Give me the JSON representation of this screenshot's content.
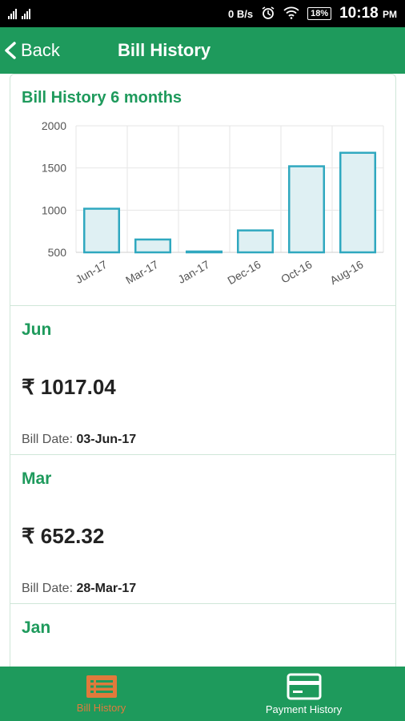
{
  "status_bar": {
    "network_speed": "0 B/s",
    "battery": "18%",
    "time": "10:18",
    "ampm": "PM"
  },
  "app_bar": {
    "back_label": "Back",
    "title": "Bill History"
  },
  "chart_card": {
    "title": "Bill History 6 months"
  },
  "chart_data": {
    "type": "bar",
    "categories": [
      "Jun-17",
      "Mar-17",
      "Jan-17",
      "Dec-16",
      "Oct-16",
      "Aug-16"
    ],
    "values": [
      1017.04,
      652.32,
      510,
      760,
      1520,
      1680
    ],
    "ylim": [
      500,
      2000
    ],
    "yticks": [
      500,
      1000,
      1500,
      2000
    ],
    "grid": true,
    "bar_fill": "#dff0f3",
    "bar_stroke": "#2fa8bf"
  },
  "bills": [
    {
      "month": "Jun",
      "currency": "₹",
      "amount": "1017.04",
      "date_label": "Bill Date:",
      "date": "03-Jun-17"
    },
    {
      "month": "Mar",
      "currency": "₹",
      "amount": "652.32",
      "date_label": "Bill Date:",
      "date": "28-Mar-17"
    },
    {
      "month": "Jan",
      "currency": "₹",
      "amount": "",
      "date_label": "",
      "date": ""
    }
  ],
  "bottom_nav": [
    {
      "label": "Bill History",
      "icon": "list-icon",
      "active": true
    },
    {
      "label": "Payment History",
      "icon": "card-icon",
      "active": false
    }
  ],
  "colors": {
    "brand_green": "#1e9a5c",
    "active_orange": "#e07a3c"
  }
}
